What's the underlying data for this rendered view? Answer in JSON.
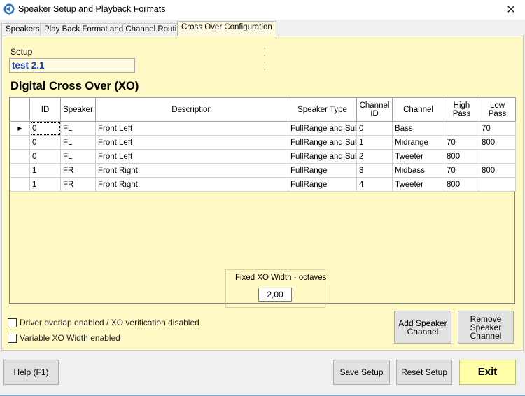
{
  "window": {
    "title": "Speaker Setup and Playback Formats",
    "close_glyph": "✕"
  },
  "tabs": [
    {
      "label": "Speakers"
    },
    {
      "label": "Play Back Format and Channel Routing"
    },
    {
      "label": "Cross Over Configuration",
      "active": true
    }
  ],
  "setup": {
    "label": "Setup",
    "value": "test 2.1"
  },
  "section": {
    "heading": "Digital Cross Over (XO)"
  },
  "grid": {
    "columns": [
      "ID",
      "Speaker",
      "Description",
      "Speaker Type",
      "Channel ID",
      "Channel",
      "High Pass",
      "Low Pass"
    ],
    "current_row_marker": "▶",
    "rows": [
      {
        "id": "0",
        "speaker": "FL",
        "description": "Front Left",
        "type": "FullRange and Sub",
        "channel_id": "0",
        "channel": "Bass",
        "high_pass": "",
        "low_pass": "70"
      },
      {
        "id": "0",
        "speaker": "FL",
        "description": "Front Left",
        "type": "FullRange and Sub",
        "channel_id": "1",
        "channel": "Midrange",
        "high_pass": "70",
        "low_pass": "800"
      },
      {
        "id": "0",
        "speaker": "FL",
        "description": "Front Left",
        "type": "FullRange and Sub",
        "channel_id": "2",
        "channel": "Tweeter",
        "high_pass": "800",
        "low_pass": ""
      },
      {
        "id": "1",
        "speaker": "FR",
        "description": "Front Right",
        "type": "FullRange",
        "channel_id": "3",
        "channel": "Midbass",
        "high_pass": "70",
        "low_pass": "800"
      },
      {
        "id": "1",
        "speaker": "FR",
        "description": "Front Right",
        "type": "FullRange",
        "channel_id": "4",
        "channel": "Tweeter",
        "high_pass": "800",
        "low_pass": ""
      }
    ]
  },
  "options": {
    "driver_overlap_label": "Driver overlap enabled / XO verification disabled",
    "driver_overlap_checked": false,
    "variable_xo_label": "Variable XO Width enabled",
    "variable_xo_checked": false
  },
  "xo_width": {
    "label": "Fixed XO Width - octaves",
    "value": "2,00"
  },
  "buttons": {
    "add_speaker_channel": "Add Speaker Channel",
    "remove_speaker_channel": "Remove Speaker Channel",
    "help": "Help (F1)",
    "save_setup": "Save Setup",
    "reset_setup": "Reset Setup",
    "exit": "Exit"
  },
  "colors": {
    "panel_bg": "#fff9c6",
    "exit_bg": "#ffffa8",
    "setup_text": "#1a3fbf"
  }
}
